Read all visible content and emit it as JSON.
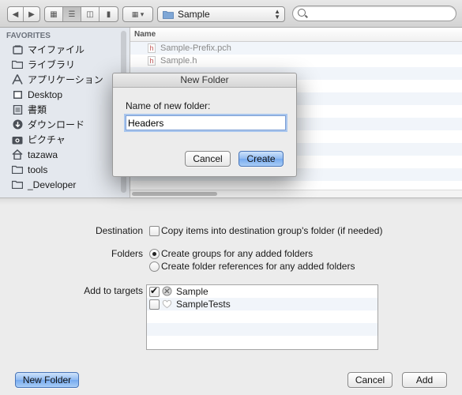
{
  "toolbar": {
    "path_popup": "Sample",
    "search_value": ""
  },
  "sidebar": {
    "header": "FAVORITES",
    "items": [
      {
        "label": "マイファイル",
        "icon": "all-my-files-icon"
      },
      {
        "label": "ライブラリ",
        "icon": "folder-icon"
      },
      {
        "label": "アプリケーション",
        "icon": "applications-icon"
      },
      {
        "label": "Desktop",
        "icon": "desktop-icon"
      },
      {
        "label": "書類",
        "icon": "documents-icon"
      },
      {
        "label": "ダウンロード",
        "icon": "downloads-icon"
      },
      {
        "label": "ピクチャ",
        "icon": "pictures-icon"
      },
      {
        "label": "tazawa",
        "icon": "home-icon"
      },
      {
        "label": "tools",
        "icon": "folder-icon"
      },
      {
        "label": "_Developer",
        "icon": "folder-icon"
      }
    ]
  },
  "filelist": {
    "column_name": "Name",
    "files": [
      "Sample-Prefix.pch",
      "Sample.h"
    ]
  },
  "dialog": {
    "title": "New Folder",
    "prompt": "Name of new folder:",
    "value": "Headers",
    "cancel_label": "Cancel",
    "create_label": "Create"
  },
  "options": {
    "destination_label": "Destination",
    "destination_checkbox": "Copy items into destination group's folder (if needed)",
    "destination_checked": false,
    "folders_label": "Folders",
    "folders_option_groups": "Create groups for any added folders",
    "folders_option_references": "Create folder references for any added folders",
    "folders_selected": "groups",
    "targets_label": "Add to targets",
    "targets": [
      {
        "name": "Sample",
        "checked": true
      },
      {
        "name": "SampleTests",
        "checked": false
      }
    ]
  },
  "buttons": {
    "new_folder": "New Folder",
    "cancel": "Cancel",
    "add": "Add"
  },
  "colors": {
    "primary_button": "#8fbaf1",
    "sidebar_bg": "#e4e8ee"
  }
}
